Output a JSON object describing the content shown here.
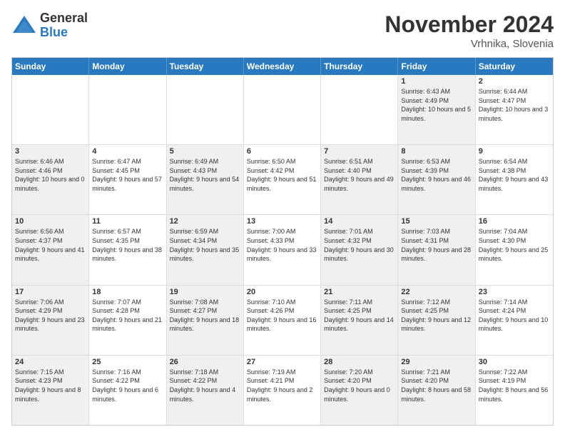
{
  "header": {
    "logo_general": "General",
    "logo_blue": "Blue",
    "month_title": "November 2024",
    "location": "Vrhnika, Slovenia"
  },
  "weekdays": [
    "Sunday",
    "Monday",
    "Tuesday",
    "Wednesday",
    "Thursday",
    "Friday",
    "Saturday"
  ],
  "rows": [
    [
      {
        "day": "",
        "info": "",
        "shaded": false,
        "empty": true
      },
      {
        "day": "",
        "info": "",
        "shaded": false,
        "empty": true
      },
      {
        "day": "",
        "info": "",
        "shaded": false,
        "empty": true
      },
      {
        "day": "",
        "info": "",
        "shaded": false,
        "empty": true
      },
      {
        "day": "",
        "info": "",
        "shaded": false,
        "empty": true
      },
      {
        "day": "1",
        "info": "Sunrise: 6:43 AM\nSunset: 4:49 PM\nDaylight: 10 hours\nand 5 minutes.",
        "shaded": true
      },
      {
        "day": "2",
        "info": "Sunrise: 6:44 AM\nSunset: 4:47 PM\nDaylight: 10 hours\nand 3 minutes.",
        "shaded": false
      }
    ],
    [
      {
        "day": "3",
        "info": "Sunrise: 6:46 AM\nSunset: 4:46 PM\nDaylight: 10 hours\nand 0 minutes.",
        "shaded": true
      },
      {
        "day": "4",
        "info": "Sunrise: 6:47 AM\nSunset: 4:45 PM\nDaylight: 9 hours\nand 57 minutes.",
        "shaded": false
      },
      {
        "day": "5",
        "info": "Sunrise: 6:49 AM\nSunset: 4:43 PM\nDaylight: 9 hours\nand 54 minutes.",
        "shaded": true
      },
      {
        "day": "6",
        "info": "Sunrise: 6:50 AM\nSunset: 4:42 PM\nDaylight: 9 hours\nand 51 minutes.",
        "shaded": false
      },
      {
        "day": "7",
        "info": "Sunrise: 6:51 AM\nSunset: 4:40 PM\nDaylight: 9 hours\nand 49 minutes.",
        "shaded": true
      },
      {
        "day": "8",
        "info": "Sunrise: 6:53 AM\nSunset: 4:39 PM\nDaylight: 9 hours\nand 46 minutes.",
        "shaded": true
      },
      {
        "day": "9",
        "info": "Sunrise: 6:54 AM\nSunset: 4:38 PM\nDaylight: 9 hours\nand 43 minutes.",
        "shaded": false
      }
    ],
    [
      {
        "day": "10",
        "info": "Sunrise: 6:56 AM\nSunset: 4:37 PM\nDaylight: 9 hours\nand 41 minutes.",
        "shaded": true
      },
      {
        "day": "11",
        "info": "Sunrise: 6:57 AM\nSunset: 4:35 PM\nDaylight: 9 hours\nand 38 minutes.",
        "shaded": false
      },
      {
        "day": "12",
        "info": "Sunrise: 6:59 AM\nSunset: 4:34 PM\nDaylight: 9 hours\nand 35 minutes.",
        "shaded": true
      },
      {
        "day": "13",
        "info": "Sunrise: 7:00 AM\nSunset: 4:33 PM\nDaylight: 9 hours\nand 33 minutes.",
        "shaded": false
      },
      {
        "day": "14",
        "info": "Sunrise: 7:01 AM\nSunset: 4:32 PM\nDaylight: 9 hours\nand 30 minutes.",
        "shaded": true
      },
      {
        "day": "15",
        "info": "Sunrise: 7:03 AM\nSunset: 4:31 PM\nDaylight: 9 hours\nand 28 minutes.",
        "shaded": true
      },
      {
        "day": "16",
        "info": "Sunrise: 7:04 AM\nSunset: 4:30 PM\nDaylight: 9 hours\nand 25 minutes.",
        "shaded": false
      }
    ],
    [
      {
        "day": "17",
        "info": "Sunrise: 7:06 AM\nSunset: 4:29 PM\nDaylight: 9 hours\nand 23 minutes.",
        "shaded": true
      },
      {
        "day": "18",
        "info": "Sunrise: 7:07 AM\nSunset: 4:28 PM\nDaylight: 9 hours\nand 21 minutes.",
        "shaded": false
      },
      {
        "day": "19",
        "info": "Sunrise: 7:08 AM\nSunset: 4:27 PM\nDaylight: 9 hours\nand 18 minutes.",
        "shaded": true
      },
      {
        "day": "20",
        "info": "Sunrise: 7:10 AM\nSunset: 4:26 PM\nDaylight: 9 hours\nand 16 minutes.",
        "shaded": false
      },
      {
        "day": "21",
        "info": "Sunrise: 7:11 AM\nSunset: 4:25 PM\nDaylight: 9 hours\nand 14 minutes.",
        "shaded": true
      },
      {
        "day": "22",
        "info": "Sunrise: 7:12 AM\nSunset: 4:25 PM\nDaylight: 9 hours\nand 12 minutes.",
        "shaded": true
      },
      {
        "day": "23",
        "info": "Sunrise: 7:14 AM\nSunset: 4:24 PM\nDaylight: 9 hours\nand 10 minutes.",
        "shaded": false
      }
    ],
    [
      {
        "day": "24",
        "info": "Sunrise: 7:15 AM\nSunset: 4:23 PM\nDaylight: 9 hours\nand 8 minutes.",
        "shaded": true
      },
      {
        "day": "25",
        "info": "Sunrise: 7:16 AM\nSunset: 4:22 PM\nDaylight: 9 hours\nand 6 minutes.",
        "shaded": false
      },
      {
        "day": "26",
        "info": "Sunrise: 7:18 AM\nSunset: 4:22 PM\nDaylight: 9 hours\nand 4 minutes.",
        "shaded": true
      },
      {
        "day": "27",
        "info": "Sunrise: 7:19 AM\nSunset: 4:21 PM\nDaylight: 9 hours\nand 2 minutes.",
        "shaded": false
      },
      {
        "day": "28",
        "info": "Sunrise: 7:20 AM\nSunset: 4:20 PM\nDaylight: 9 hours\nand 0 minutes.",
        "shaded": true
      },
      {
        "day": "29",
        "info": "Sunrise: 7:21 AM\nSunset: 4:20 PM\nDaylight: 8 hours\nand 58 minutes.",
        "shaded": true
      },
      {
        "day": "30",
        "info": "Sunrise: 7:22 AM\nSunset: 4:19 PM\nDaylight: 8 hours\nand 56 minutes.",
        "shaded": false
      }
    ]
  ]
}
